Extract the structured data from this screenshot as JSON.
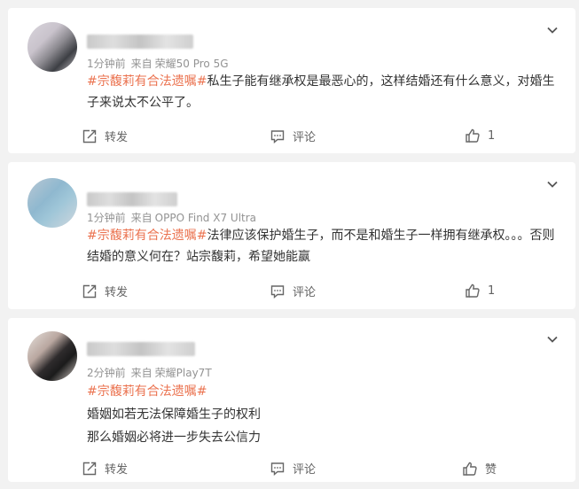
{
  "comments": [
    {
      "time": "1分钟前",
      "source_label": "来自",
      "device": "荣耀50 Pro 5G",
      "tag": "#宗馥莉有合法遗嘱#",
      "text": "私生子能有继承权是最恶心的，这样结婚还有什么意义，对婚生子来说太不公平了。",
      "lines": [],
      "forward_label": "转发",
      "comment_label": "评论",
      "like_count": "1"
    },
    {
      "time": "1分钟前",
      "source_label": "来自",
      "device": "OPPO Find X7 Ultra",
      "tag": "#宗馥莉有合法遗嘱#",
      "text": "法律应该保护婚生子，而不是和婚生子一样拥有继承权。。。否则结婚的意义何在？站宗馥莉，希望她能赢",
      "lines": [],
      "forward_label": "转发",
      "comment_label": "评论",
      "like_count": "1"
    },
    {
      "time": "2分钟前",
      "source_label": "来自",
      "device": "荣耀Play7T",
      "tag": "#宗馥莉有合法遗嘱#",
      "text": "",
      "lines": [
        "婚姻如若无法保障婚生子的权利",
        "那么婚姻必将进一步失去公信力"
      ],
      "forward_label": "转发",
      "comment_label": "评论",
      "like_count": "赞"
    }
  ],
  "icons": {
    "expand": "chevron-down-icon",
    "forward": "forward-icon",
    "comment": "comment-icon",
    "like": "thumbs-up-icon"
  }
}
